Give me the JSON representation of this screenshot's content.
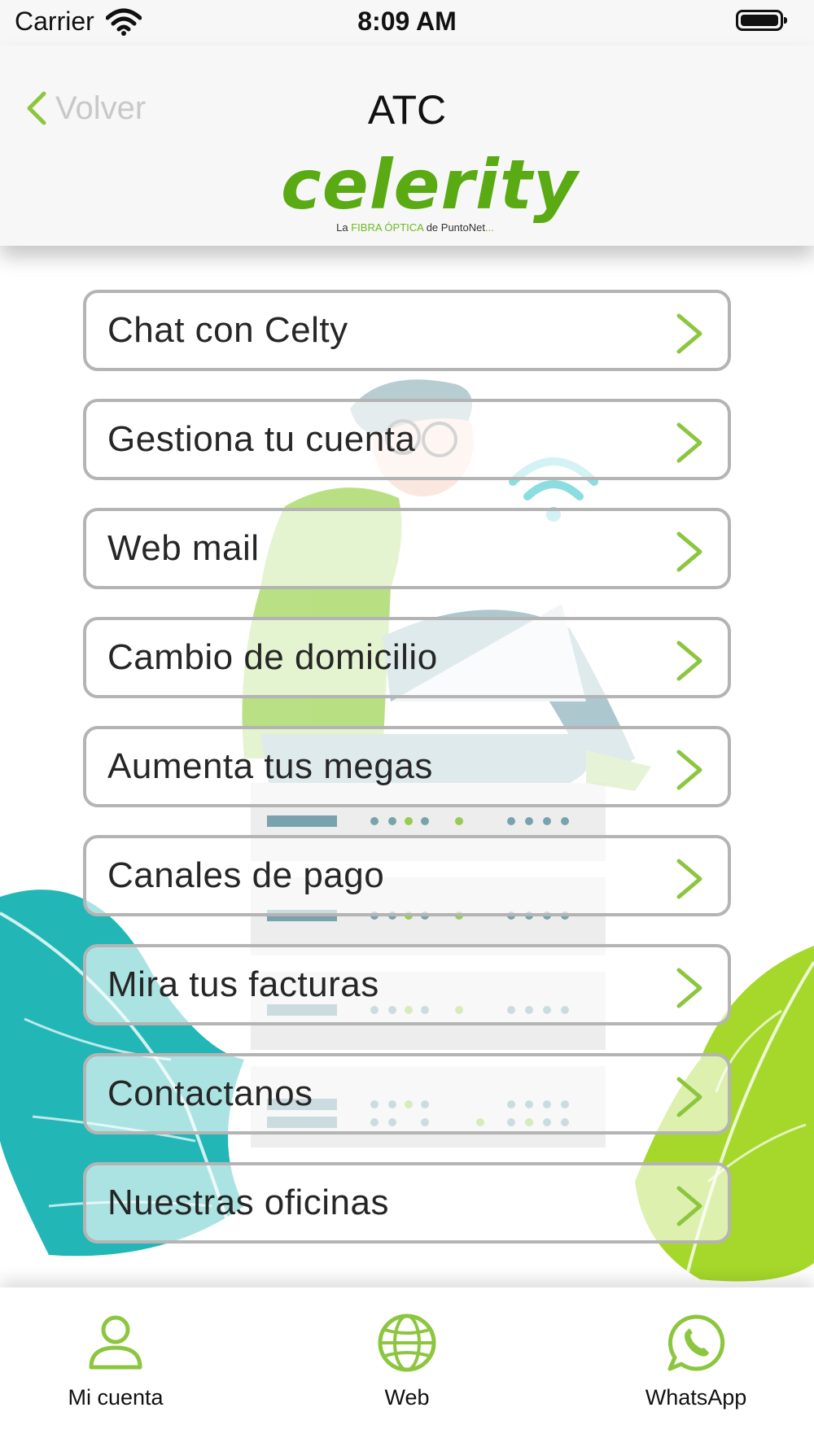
{
  "status_bar": {
    "carrier": "Carrier",
    "time": "8:09 AM"
  },
  "nav": {
    "back_label": "Volver",
    "title": "ATC",
    "logo_word": "celerity",
    "logo_tagline_prefix": "La ",
    "logo_tagline_highlight": "FIBRA ÓPTICA",
    "logo_tagline_suffix": " de PuntoNet",
    "logo_tagline_dots": "..."
  },
  "menu": {
    "items": [
      {
        "label": "Chat con Celty"
      },
      {
        "label": "Gestiona tu cuenta"
      },
      {
        "label": "Web mail"
      },
      {
        "label": "Cambio de domicilio"
      },
      {
        "label": "Aumenta tus megas"
      },
      {
        "label": "Canales de pago"
      },
      {
        "label": "Mira tus facturas"
      },
      {
        "label": "Contactanos"
      },
      {
        "label": "Nuestras oficinas"
      }
    ]
  },
  "tab_bar": {
    "tabs": [
      {
        "label": "Mi cuenta",
        "icon": "person-icon"
      },
      {
        "label": "Web",
        "icon": "globe-icon"
      },
      {
        "label": "WhatsApp",
        "icon": "whatsapp-icon"
      }
    ]
  },
  "colors": {
    "accent_green": "#8cc63f",
    "logo_green": "#5aaa14",
    "button_border": "#b4b4b4",
    "back_label": "#c8c8c8",
    "teal_leaf": "#17b3b3"
  }
}
